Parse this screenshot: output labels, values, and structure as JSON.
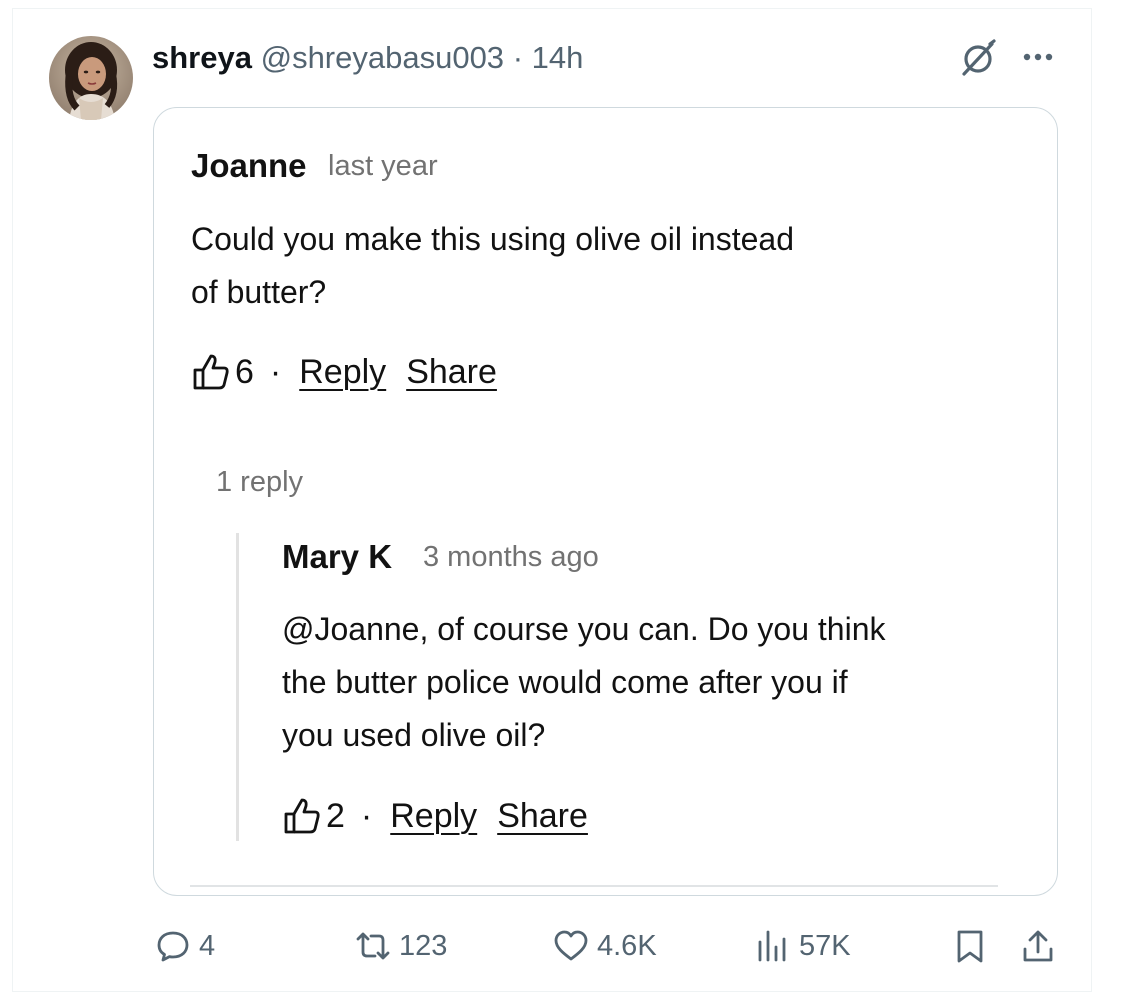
{
  "post": {
    "author_name": "shreya",
    "author_handle": "@shreyabasu003",
    "separator": "·",
    "time": "14h"
  },
  "comment": {
    "author": "Joanne",
    "time": "last year",
    "text_line1": "Could you make this using olive oil instead",
    "text_line2": "of butter?",
    "likes": "6",
    "dot": "·",
    "reply_label": "Reply",
    "share_label": "Share"
  },
  "replies_count_label": "1 reply",
  "reply": {
    "author": "Mary K",
    "time": "3 months ago",
    "text_line1": "@Joanne, of course you can. Do you think",
    "text_line2": "the butter police would come after you if",
    "text_line3": "you used olive oil?",
    "likes": "2",
    "dot": "·",
    "reply_label": "Reply",
    "share_label": "Share"
  },
  "stats": {
    "replies": "4",
    "reposts": "123",
    "likes": "4.6K",
    "views": "57K"
  },
  "icons": {
    "reply": "speech-bubble-icon",
    "repost": "repost-icon",
    "like": "heart-icon",
    "views": "bar-chart-icon",
    "bookmark": "bookmark-icon",
    "share": "share-upload-icon",
    "grok": "grok-icon",
    "more": "more-dots-icon",
    "thumb": "thumbs-up-icon"
  },
  "colors": {
    "secondary_text": "#536471",
    "card_border": "#cfd9de",
    "comment_meta": "#727272"
  }
}
